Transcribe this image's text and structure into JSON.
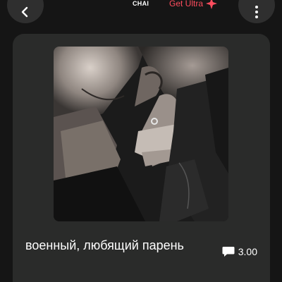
{
  "header": {
    "brand": "CHAI",
    "ultra_label": "Get Ultra",
    "back_icon": "chevron-left-icon",
    "more_icon": "vertical-ellipsis-icon",
    "ultra_icon": "sparkle-icon"
  },
  "bot": {
    "name": "военный, любящий парень",
    "rating": "3.00",
    "rating_icon": "chat-bubble-icon",
    "image_alt": "dark photo of a couple"
  },
  "colors": {
    "background": "#151515",
    "card": "#2a2b2a",
    "button": "#2f2f2f",
    "ultra_accent": "#ff4d5e"
  }
}
